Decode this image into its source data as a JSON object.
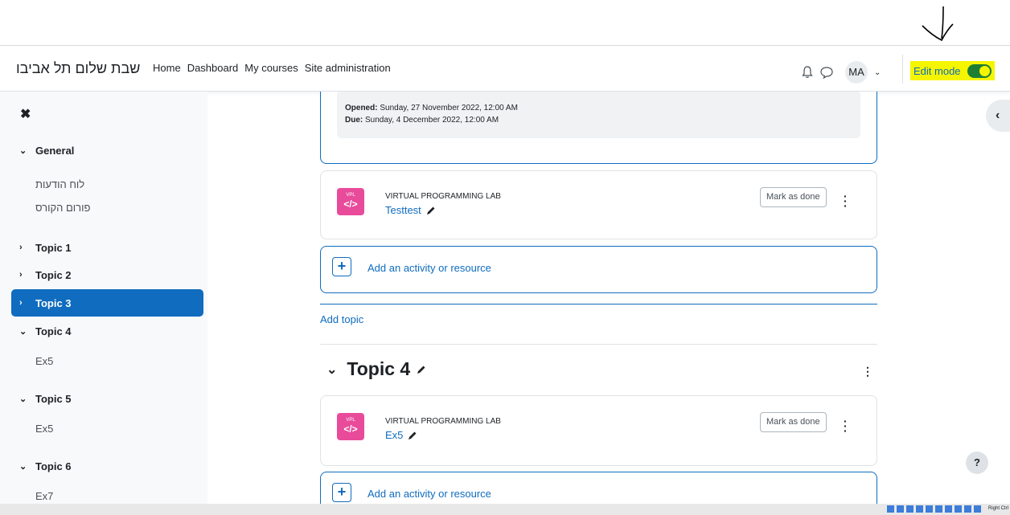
{
  "site": {
    "brand": "שבת שלום תל אביבו"
  },
  "nav": {
    "items": [
      "Home",
      "Dashboard",
      "My courses",
      "Site administration"
    ]
  },
  "user": {
    "initials": "MA"
  },
  "edit_mode": {
    "label": "Edit mode",
    "on": true,
    "highlight_color": "#f5f500"
  },
  "drawer": {
    "close_label": "✖",
    "items": [
      {
        "label": "General",
        "chevron": "⌄",
        "kind": "section"
      },
      {
        "label": "לוח הודעות",
        "kind": "sub"
      },
      {
        "label": "פורום הקורס",
        "kind": "sub"
      },
      {
        "label": "Topic 1",
        "chevron": "›",
        "kind": "section"
      },
      {
        "label": "Topic 2",
        "chevron": "›",
        "kind": "section"
      },
      {
        "label": "Topic 3",
        "chevron": "›",
        "kind": "section",
        "active": true
      },
      {
        "label": "Topic 4",
        "chevron": "⌄",
        "kind": "section"
      },
      {
        "label": "Ex5",
        "kind": "sub"
      },
      {
        "label": "Topic 5",
        "chevron": "⌄",
        "kind": "section"
      },
      {
        "label": "Ex5",
        "kind": "sub"
      },
      {
        "label": "Topic 6",
        "chevron": "⌄",
        "kind": "section"
      },
      {
        "label": "Ex7",
        "kind": "sub"
      }
    ]
  },
  "dates": {
    "opened_label": "Opened:",
    "opened_value": "Sunday, 27 November 2022, 12:00 AM",
    "due_label": "Due:",
    "due_value": "Sunday, 4 December 2022, 12:00 AM"
  },
  "activities": [
    {
      "type": "VIRTUAL PROGRAMMING LAB",
      "name": "Testtest",
      "icon_text": "VPL",
      "icon_code": "</>",
      "mark_label": "Mark as done"
    },
    {
      "type": "VIRTUAL PROGRAMMING LAB",
      "name": "Ex5",
      "icon_text": "VPL",
      "icon_code": "</>",
      "mark_label": "Mark as done"
    }
  ],
  "add_activity": "Add an activity or resource",
  "add_topic": "Add topic",
  "topic4": {
    "title": "Topic 4"
  },
  "index_toggle": "‹",
  "help": "?",
  "taskbar": {
    "label": "Right Ctrl"
  },
  "colors": {
    "accent": "#0f6cbf",
    "vpl": "#e94b9b",
    "toggle_on": "#1e7e34"
  }
}
